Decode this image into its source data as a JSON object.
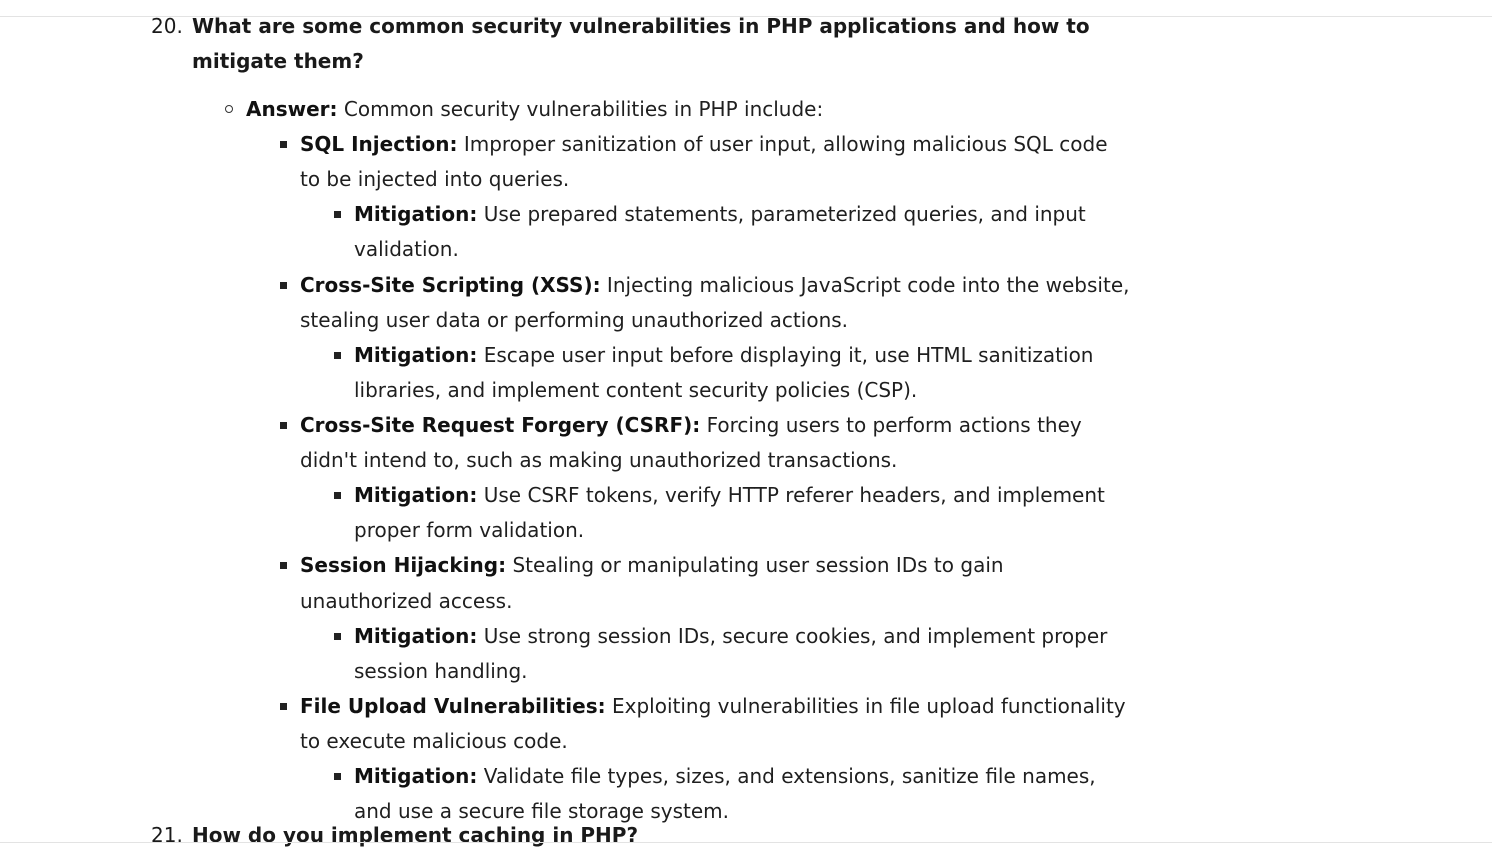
{
  "question20": {
    "number": "20.",
    "line1": "What are some common security vulnerabilities in PHP applications and how to",
    "line2": "mitigate them?"
  },
  "answer": {
    "label": "Answer:",
    "text": " Common security vulnerabilities in PHP include:"
  },
  "items": [
    {
      "title": "SQL Injection:",
      "line1": " Improper sanitization of user input, allowing malicious SQL code",
      "line2": "to be injected into queries.",
      "mitigation_label": "Mitigation:",
      "mitigation_line1": " Use prepared statements, parameterized queries, and input",
      "mitigation_line2": "validation."
    },
    {
      "title": "Cross-Site Scripting (XSS):",
      "line1": " Injecting malicious JavaScript code into the website,",
      "line2": "stealing user data or performing unauthorized actions.",
      "mitigation_label": "Mitigation:",
      "mitigation_line1": " Escape user input before displaying it, use HTML sanitization",
      "mitigation_line2": "libraries, and implement content security policies (CSP)."
    },
    {
      "title": "Cross-Site Request Forgery (CSRF):",
      "line1": " Forcing users to perform actions they",
      "line2": "didn't intend to, such as making unauthorized transactions.",
      "mitigation_label": "Mitigation:",
      "mitigation_line1": " Use CSRF tokens, verify HTTP referer headers, and implement",
      "mitigation_line2": "proper form validation."
    },
    {
      "title": "Session Hijacking:",
      "line1": " Stealing or manipulating user session IDs to gain",
      "line2": "unauthorized access.",
      "mitigation_label": "Mitigation:",
      "mitigation_line1": " Use strong session IDs, secure cookies, and implement proper",
      "mitigation_line2": "session handling."
    },
    {
      "title": "File Upload Vulnerabilities:",
      "line1": " Exploiting vulnerabilities in file upload functionality",
      "line2": "to execute malicious code.",
      "mitigation_label": "Mitigation:",
      "mitigation_line1": " Validate file types, sizes, and extensions, sanitize file names,",
      "mitigation_line2": "and use a secure file storage system."
    }
  ],
  "question21": {
    "number": "21.",
    "text": "How do you implement caching in PHP?"
  }
}
